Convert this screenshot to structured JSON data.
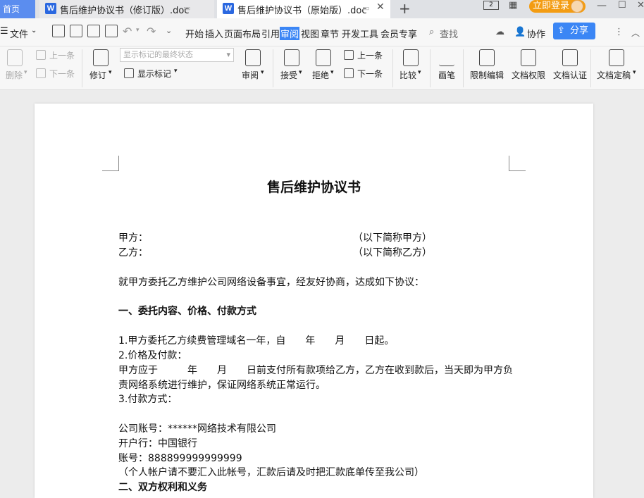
{
  "tabs": {
    "home": "首页",
    "tab1": "售后维护协议书（修订版）.doc",
    "tab2": "售后维护协议书（原始版）.doc",
    "new_tab": "+"
  },
  "window": {
    "login": "立即登录"
  },
  "menu": {
    "file": "文件",
    "items": [
      "开始",
      "插入",
      "页面布局",
      "引用",
      "审阅",
      "视图",
      "章节",
      "开发工具",
      "会员专享"
    ],
    "active": "审阅",
    "search": "查找",
    "collab": "协作",
    "share": "分享"
  },
  "ribbon": {
    "delete": "删除",
    "prev": "上一条",
    "next": "下一条",
    "revise": "修订",
    "markup_state": "显示标记的最终状态",
    "show_markup": "显示标记",
    "review": "审阅",
    "accept": "接受",
    "reject": "拒绝",
    "prev2": "上一条",
    "next2": "下一条",
    "compare": "比较",
    "pen": "画笔",
    "restrict": "限制编辑",
    "doc_permission": "文档权限",
    "doc_cert": "文档认证",
    "doc_final": "文档定稿"
  },
  "document": {
    "title": "售后维护协议书",
    "party_a": "甲方：",
    "party_a_note": "（以下简称甲方）",
    "party_b": "乙方：",
    "party_b_note": "（以下简称乙方）",
    "intro": "就甲方委托乙方维护公司网络设备事宜，经友好协商，达成如下协议：",
    "section1": "一、委托内容、价格、付款方式",
    "item1": "1.甲方委托乙方续费管理域名一年，自　　年　　月　　日起。",
    "item2": "2.价格及付款：",
    "item2_text1": "甲方应于　　　年　　月　　日前支付所有款项给乙方，乙方在收到款后，当天即为甲方负",
    "item2_text2": "责网络系统进行维护，保证网络系统正常运行。",
    "item3": "3.付款方式：",
    "account": "公司账号：******网络技术有限公司",
    "bank": "开户行：中国银行",
    "account_no": "账号：888899999999999",
    "notice": "（个人帐户请不要汇入此帐号，汇款后请及时把汇款底单传至我公司）",
    "section2": "二、双方权利和义务"
  }
}
